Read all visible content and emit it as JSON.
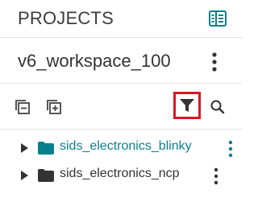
{
  "header": {
    "title": "PROJECTS",
    "icon": "workspace-panel-icon"
  },
  "workspace": {
    "name": "v6_workspace_100",
    "menu_icon": "more-vertical-icon"
  },
  "toolbar": {
    "buttons": [
      {
        "icon": "collapse-all-icon"
      },
      {
        "icon": "add-project-icon"
      },
      {
        "icon": "filter-icon",
        "highlighted": true,
        "highlight_color": "#e0141e"
      },
      {
        "icon": "search-icon"
      }
    ]
  },
  "tree": {
    "items": [
      {
        "label": "sids_electronics_blinky",
        "icon": "folder-icon",
        "color": "#0a7f8c",
        "expanded": false
      },
      {
        "label": "sids_electronics_ncp",
        "icon": "folder-icon",
        "color": "#333333",
        "expanded": false
      }
    ]
  },
  "colors": {
    "accent": "#0a7f8c",
    "highlight": "#e0141e",
    "text": "#333333",
    "divider": "#e2e2e2"
  }
}
